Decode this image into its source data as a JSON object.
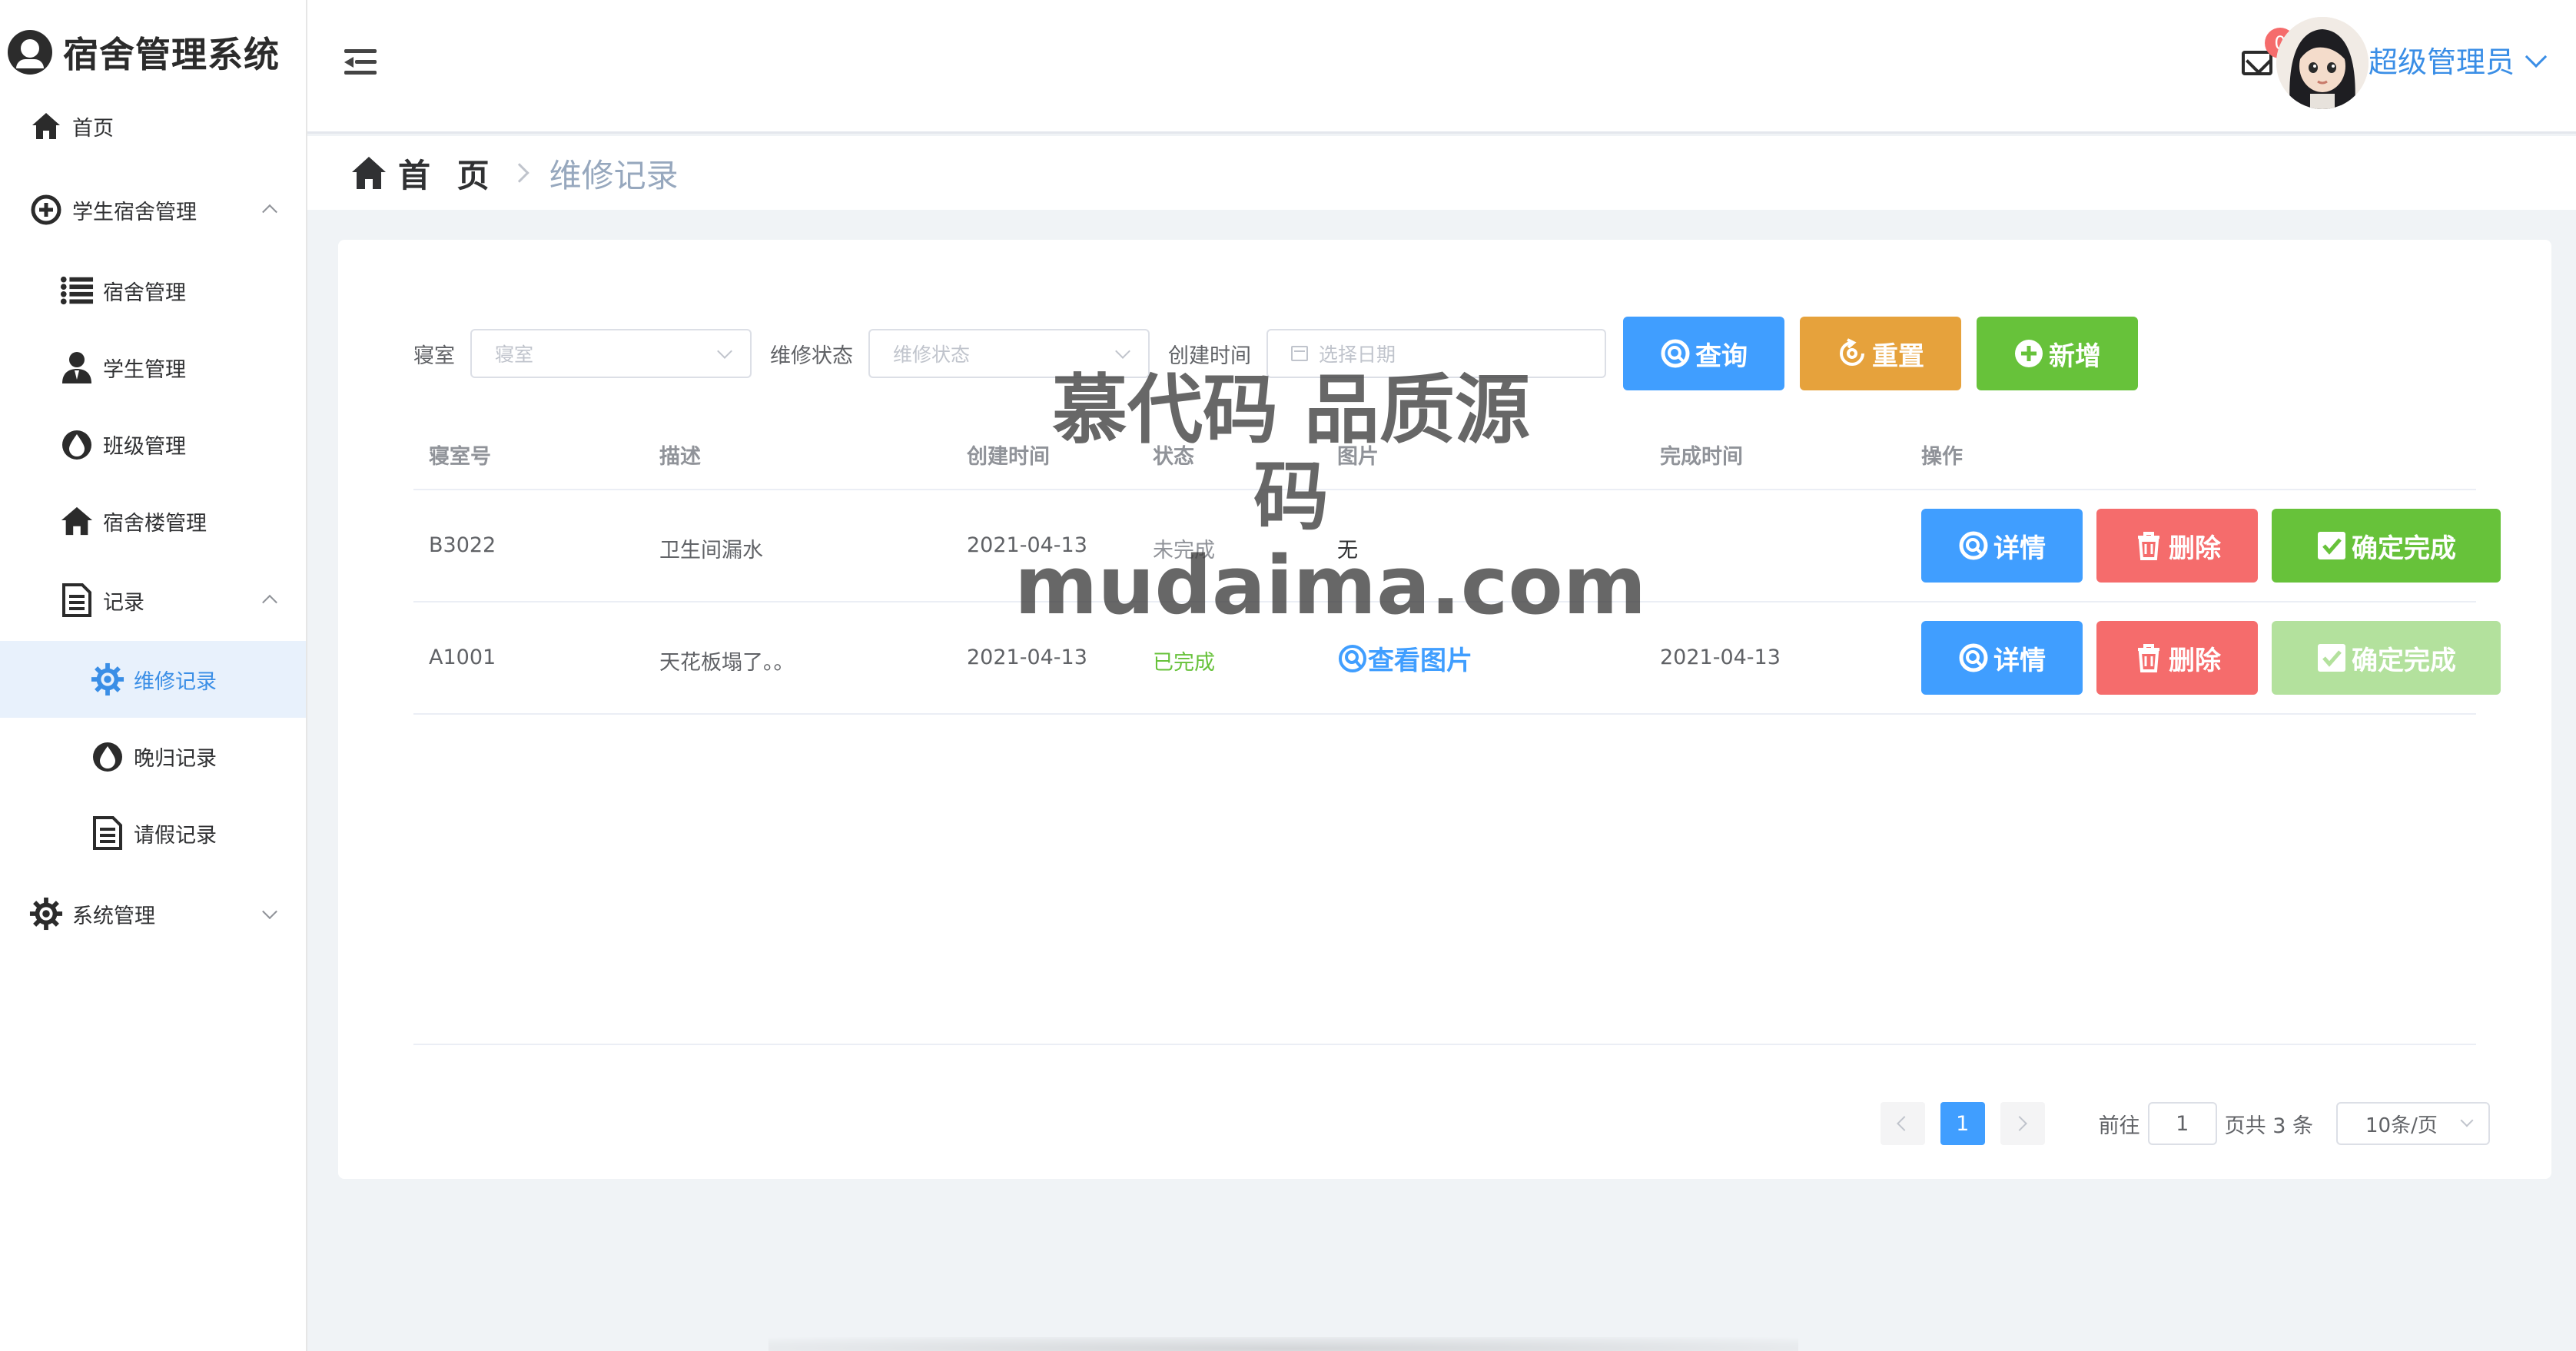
{
  "app": {
    "title": "宿舍管理系统"
  },
  "sidebar": {
    "items": [
      {
        "label": "首页",
        "icon": "home-icon"
      },
      {
        "label": "学生宿舍管理",
        "icon": "plus-circle-icon"
      },
      {
        "label": "宿舍管理",
        "icon": "list-icon"
      },
      {
        "label": "学生管理",
        "icon": "user-icon"
      },
      {
        "label": "班级管理",
        "icon": "drop-icon"
      },
      {
        "label": "宿舍楼管理",
        "icon": "building-icon"
      },
      {
        "label": "记录",
        "icon": "document-icon"
      },
      {
        "label": "维修记录",
        "icon": "gear-icon",
        "active": true
      },
      {
        "label": "晚归记录",
        "icon": "drop-icon"
      },
      {
        "label": "请假记录",
        "icon": "document-icon"
      },
      {
        "label": "系统管理",
        "icon": "gear-icon"
      }
    ]
  },
  "header": {
    "badge_count": "0",
    "username": "超级管理员"
  },
  "breadcrumb": {
    "home": "首 页",
    "current": "维修记录"
  },
  "filters": {
    "room_label": "寝室",
    "room_placeholder": "寝室",
    "status_label": "维修状态",
    "status_placeholder": "维修状态",
    "date_label": "创建时间",
    "date_placeholder": "选择日期",
    "query_label": "查询",
    "reset_label": "重置",
    "add_label": "新增"
  },
  "table": {
    "headers": [
      "寝室号",
      "描述",
      "创建时间",
      "状态",
      "图片",
      "完成时间",
      "操作"
    ],
    "rows": [
      {
        "room": "B3022",
        "desc": "卫生间漏水",
        "created": "2021-04-13",
        "status": "未完成",
        "image": "无",
        "finished": ""
      },
      {
        "room": "A1001",
        "desc": "天花板塌了。。",
        "created": "2021-04-13",
        "status": "已完成",
        "image": "查看图片",
        "finished": "2021-04-13"
      }
    ],
    "detail_label": "详情",
    "delete_label": "删除",
    "confirm_label": "确定完成"
  },
  "pagination": {
    "current_page": "1",
    "goto_label": "前往",
    "goto_value": "1",
    "total_text": "页共 3 条",
    "page_size": "10条/页"
  },
  "watermark": {
    "line1": "慕代码 品质源码",
    "line2": "mudaima.com"
  },
  "colors": {
    "primary": "#409eff",
    "warning": "#e6a23c",
    "success": "#67c23a",
    "danger": "#f56c6c",
    "success_light": "#b3e19d"
  }
}
